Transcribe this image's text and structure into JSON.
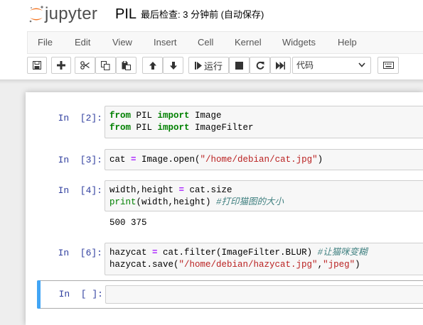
{
  "header": {
    "logo_text": "jupyter",
    "notebook_name": "PIL",
    "checkpoint_status": "最后检查: 3 分钟前  (自动保存)"
  },
  "menubar": {
    "items": [
      {
        "id": "file",
        "label": "File"
      },
      {
        "id": "edit",
        "label": "Edit"
      },
      {
        "id": "view",
        "label": "View"
      },
      {
        "id": "insert",
        "label": "Insert"
      },
      {
        "id": "cell",
        "label": "Cell"
      },
      {
        "id": "kernel",
        "label": "Kernel"
      },
      {
        "id": "widgets",
        "label": "Widgets"
      },
      {
        "id": "help",
        "label": "Help"
      }
    ]
  },
  "toolbar": {
    "run_label": "运行",
    "cell_type": "代码",
    "buttons": [
      "save-icon",
      "plus-icon",
      "scissors-icon",
      "copy-icon",
      "paste-icon",
      "arrow-up-icon",
      "arrow-down-icon",
      "step-forward-icon",
      "stop-icon",
      "restart-icon",
      "fast-forward-icon",
      "keyboard-icon"
    ]
  },
  "cells": [
    {
      "prompt": "In  [2]:",
      "lines": [
        [
          {
            "t": "from",
            "c": "kw"
          },
          {
            "t": " PIL "
          },
          {
            "t": "import",
            "c": "kw"
          },
          {
            "t": " Image"
          }
        ],
        [
          {
            "t": "from",
            "c": "kw"
          },
          {
            "t": " PIL "
          },
          {
            "t": "import",
            "c": "kw"
          },
          {
            "t": " ImageFilter"
          }
        ]
      ],
      "output": ""
    },
    {
      "prompt": "In  [3]:",
      "lines": [
        [
          {
            "t": "cat "
          },
          {
            "t": "=",
            "c": "op"
          },
          {
            "t": " Image.open("
          },
          {
            "t": "\"/home/debian/cat.jpg\"",
            "c": "str"
          },
          {
            "t": ")"
          }
        ]
      ],
      "output": ""
    },
    {
      "prompt": "In  [4]:",
      "lines": [
        [
          {
            "t": "width,height "
          },
          {
            "t": "=",
            "c": "op"
          },
          {
            "t": " cat.size"
          }
        ],
        [
          {
            "t": "print",
            "c": "bi"
          },
          {
            "t": "(width,height) "
          },
          {
            "t": "#打印猫图的大小",
            "c": "cm"
          }
        ]
      ],
      "output": "500 375"
    },
    {
      "prompt": "In  [6]:",
      "lines": [
        [
          {
            "t": "hazycat "
          },
          {
            "t": "=",
            "c": "op"
          },
          {
            "t": " cat.filter(ImageFilter.BLUR) "
          },
          {
            "t": "#让猫咪变糊",
            "c": "cm"
          }
        ],
        [
          {
            "t": "hazycat.save("
          },
          {
            "t": "\"/home/debian/hazycat.jpg\"",
            "c": "str"
          },
          {
            "t": ","
          },
          {
            "t": "\"jpeg\"",
            "c": "str"
          },
          {
            "t": ")"
          }
        ]
      ],
      "output": ""
    },
    {
      "prompt": "In  [ ]:",
      "lines": [],
      "output": ""
    }
  ],
  "colors": {
    "prompt": "#303f9f",
    "keyword": "#008000",
    "operator": "#aa22ff",
    "string": "#ba2121",
    "comment": "#408080",
    "selected_cell_bar": "#42a5f5"
  }
}
